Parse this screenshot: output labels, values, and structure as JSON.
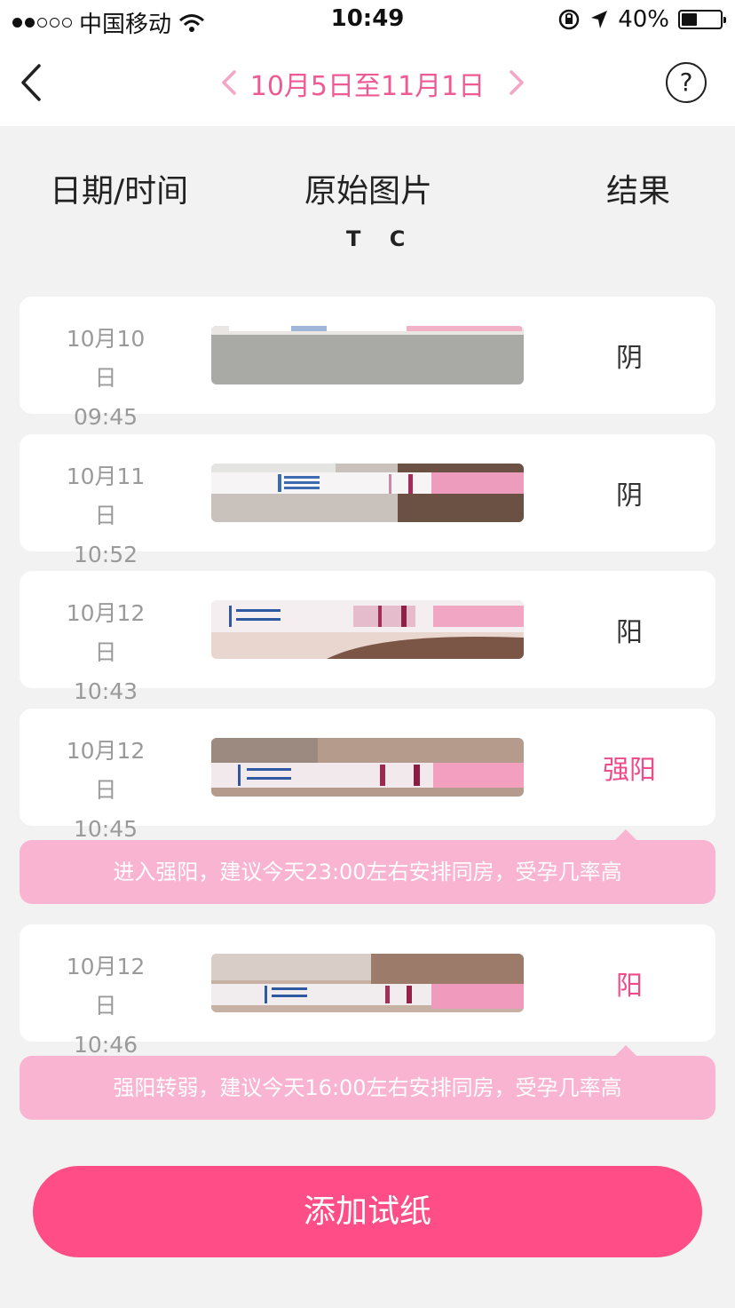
{
  "status_bar": {
    "carrier": "中国移动",
    "time": "10:49",
    "battery": "40%",
    "battery_level": 0.4,
    "icons": [
      "signal-dots",
      "wifi-icon",
      "orientation-lock-icon",
      "location-arrow-icon",
      "battery-icon"
    ]
  },
  "nav": {
    "back_icon": "chevron-left-icon",
    "date_range": "10月5日至11月1日",
    "prev_icon": "chevron-left-icon",
    "next_icon": "chevron-right-icon",
    "help_label": "?",
    "accent_color": "#ef5a95"
  },
  "table": {
    "headers": {
      "date": "日期/时间",
      "image": "原始图片",
      "result": "结果",
      "tc": "T C"
    },
    "rows": [
      {
        "date": "10月10日",
        "time": "09:45",
        "result": "阴"
      },
      {
        "date": "10月11日",
        "time": "10:52",
        "result": "阴"
      },
      {
        "date": "10月12日",
        "time": "10:43",
        "result": "阳"
      },
      {
        "date": "10月12日",
        "time": "10:45",
        "result": "强阳",
        "tip": "进入强阳，建议今天23:00左右安排同房，受孕几率高"
      },
      {
        "date": "10月12日",
        "time": "10:46",
        "result": "阳",
        "tip": "强阳转弱，建议今天16:00左右安排同房，受孕几率高"
      }
    ]
  },
  "add_button": "添加试纸",
  "colors": {
    "button": "#fe4d87",
    "tip_bg": "#f9b4d1",
    "result_highlight": "#ef4b8a"
  }
}
